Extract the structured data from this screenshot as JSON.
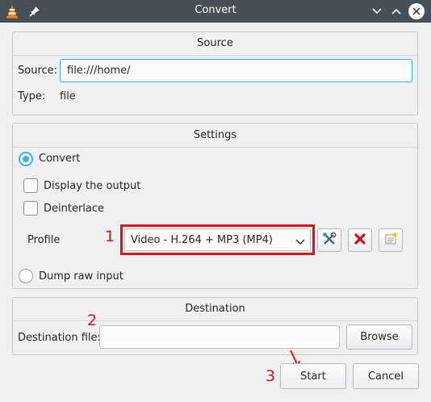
{
  "window": {
    "title": "Convert",
    "app_icon": "vlc-cone-icon",
    "pin_icon": "pin-icon",
    "controls": [
      "minimize-icon",
      "maximize-icon",
      "close-icon"
    ]
  },
  "source": {
    "heading": "Source",
    "source_label": "Source:",
    "source_value": "file:///home/",
    "type_label": "Type:",
    "type_value": "file"
  },
  "settings": {
    "heading": "Settings",
    "convert_label": "Convert",
    "convert_selected": true,
    "display_output_label": "Display the output",
    "display_output_checked": false,
    "deinterlace_label": "Deinterlace",
    "deinterlace_checked": false,
    "profile_label": "Profile",
    "profile_value": "Video - H.264 + MP3 (MP4)",
    "edit_profile_icon": "tools-icon",
    "delete_profile_icon": "delete-x-icon",
    "new_profile_icon": "new-profile-icon",
    "dump_raw_label": "Dump raw input",
    "dump_raw_selected": false
  },
  "destination": {
    "heading": "Destination",
    "file_label": "Destination file:",
    "file_value": "",
    "browse_label": "Browse"
  },
  "actions": {
    "start_label": "Start",
    "cancel_label": "Cancel"
  },
  "annotations": {
    "step1": "1",
    "step2": "2",
    "step3": "3",
    "color": "#e0101a"
  },
  "colors": {
    "titlebar": "#475057",
    "accent": "#3daee9",
    "window_bg": "#eff0f1"
  }
}
